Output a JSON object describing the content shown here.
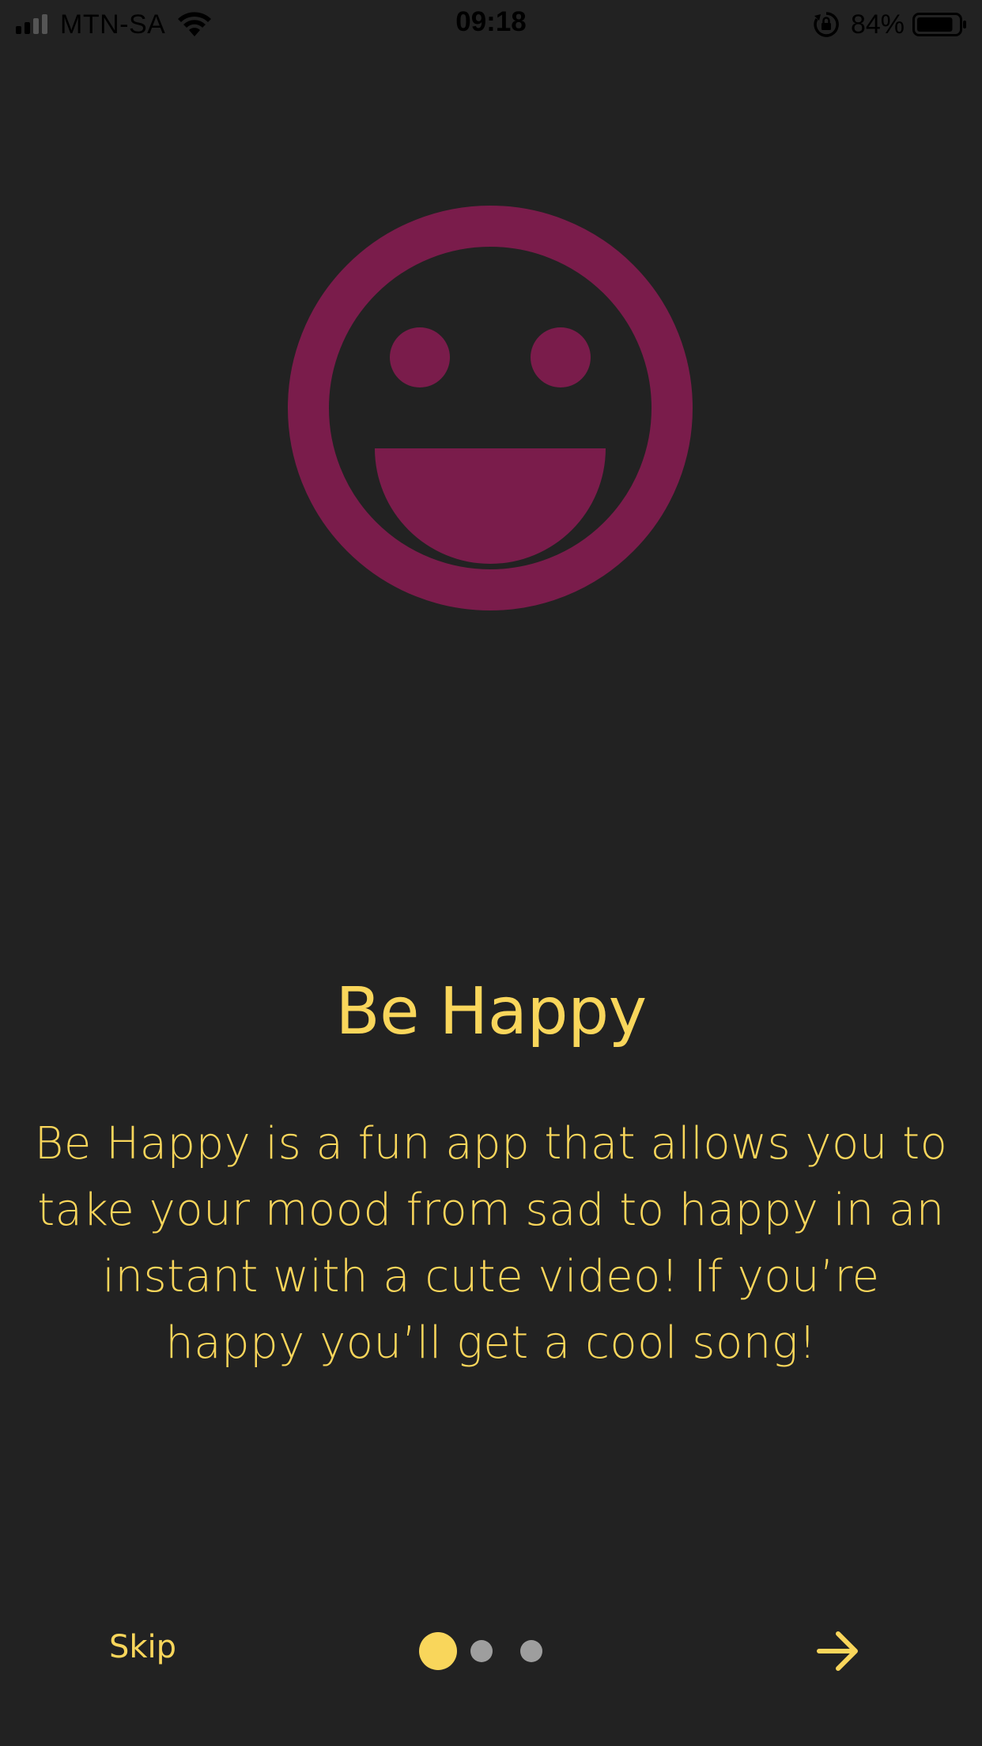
{
  "status_bar": {
    "carrier": "MTN-SA",
    "time": "09:18",
    "battery_percent": "84%",
    "signal_bars_total": 4,
    "signal_bars_active": 2,
    "battery_level": 0.84
  },
  "onboarding": {
    "icon": "smiley-face-icon",
    "title": "Be Happy",
    "description": "Be Happy is a fun app that allows you to take your mood from sad to happy in an instant with a cute video! If you’re happy you’ll get a cool song!",
    "pagination": {
      "total": 3,
      "current": 1
    }
  },
  "navigation": {
    "skip_label": "Skip",
    "next_icon": "arrow-right-icon"
  },
  "colors": {
    "background": "#222222",
    "accent_yellow": "#f9d65b",
    "smiley_magenta": "#7a1c4b",
    "inactive_dot": "#9e9e9e"
  }
}
